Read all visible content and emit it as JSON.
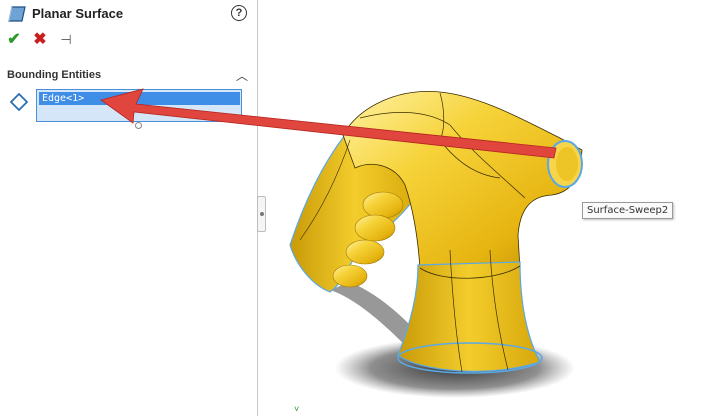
{
  "property_manager": {
    "title": "Planar Surface",
    "feature_icon": "planar-surface-icon",
    "help_icon": "help-icon",
    "help_glyph": "?",
    "actions": {
      "ok_glyph": "✔",
      "cancel_glyph": "✖",
      "pin_glyph": "⊣"
    }
  },
  "bounding_entities": {
    "section_title": "Bounding Entities",
    "collapse_glyph": "︿",
    "entity_icon": "edge-selection-icon",
    "selected_items": [
      "Edge<1>"
    ]
  },
  "graphics": {
    "model_name": "Surface-Sweep2",
    "model_color": "#f2c418",
    "highlight_color": "#5aa9e6",
    "arrow_color": "#e0453e",
    "triad_glyph": "˅"
  }
}
